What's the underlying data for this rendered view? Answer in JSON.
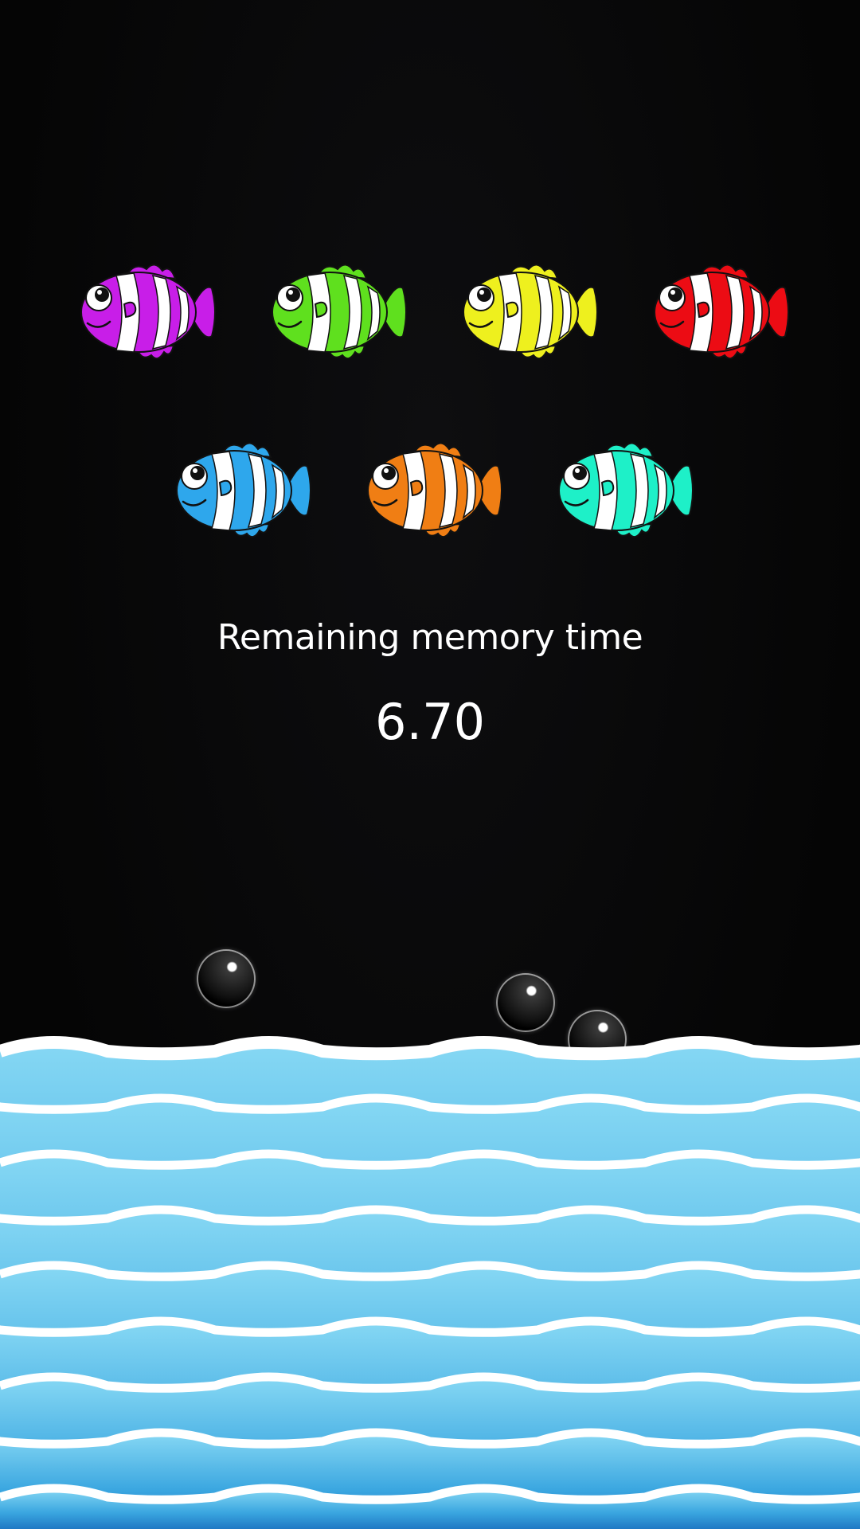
{
  "game": {
    "label": "Remaining memory time",
    "timer": "6.70"
  },
  "fish": [
    {
      "color": "#c81ee8",
      "name": "purple"
    },
    {
      "color": "#5fe01e",
      "name": "green"
    },
    {
      "color": "#eef01e",
      "name": "yellow"
    },
    {
      "color": "#ec0c14",
      "name": "red"
    },
    {
      "color": "#2ea7ec",
      "name": "blue"
    },
    {
      "color": "#f07e14",
      "name": "orange"
    },
    {
      "color": "#1ef0c8",
      "name": "teal"
    }
  ],
  "colors": {
    "background": "#050505",
    "wave_light": "#7fd3f2",
    "wave_dark": "#1e7fc8",
    "wave_crest": "#ffffff"
  }
}
